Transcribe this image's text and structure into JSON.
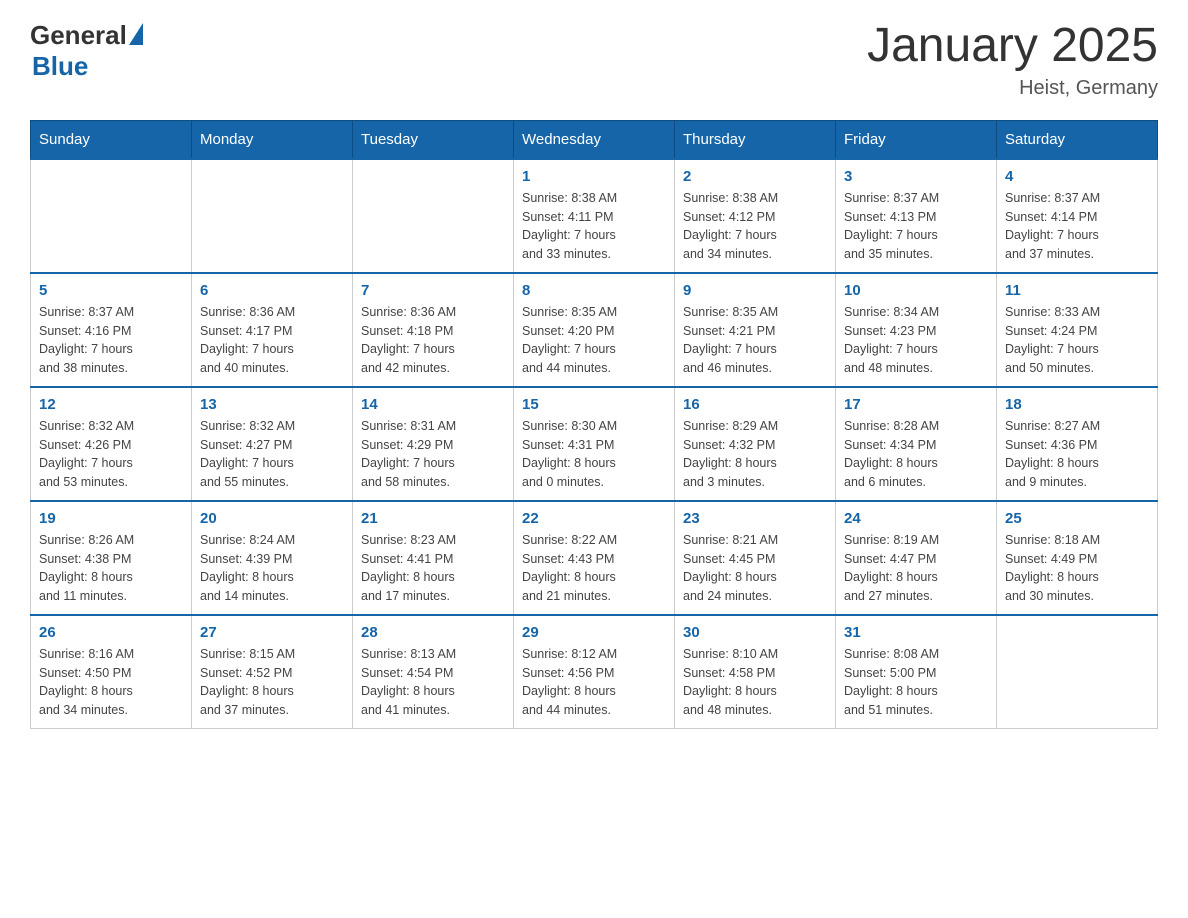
{
  "header": {
    "logo_general": "General",
    "logo_blue": "Blue",
    "title": "January 2025",
    "subtitle": "Heist, Germany"
  },
  "calendar": {
    "days_of_week": [
      "Sunday",
      "Monday",
      "Tuesday",
      "Wednesday",
      "Thursday",
      "Friday",
      "Saturday"
    ],
    "weeks": [
      [
        {
          "day": "",
          "info": ""
        },
        {
          "day": "",
          "info": ""
        },
        {
          "day": "",
          "info": ""
        },
        {
          "day": "1",
          "info": "Sunrise: 8:38 AM\nSunset: 4:11 PM\nDaylight: 7 hours\nand 33 minutes."
        },
        {
          "day": "2",
          "info": "Sunrise: 8:38 AM\nSunset: 4:12 PM\nDaylight: 7 hours\nand 34 minutes."
        },
        {
          "day": "3",
          "info": "Sunrise: 8:37 AM\nSunset: 4:13 PM\nDaylight: 7 hours\nand 35 minutes."
        },
        {
          "day": "4",
          "info": "Sunrise: 8:37 AM\nSunset: 4:14 PM\nDaylight: 7 hours\nand 37 minutes."
        }
      ],
      [
        {
          "day": "5",
          "info": "Sunrise: 8:37 AM\nSunset: 4:16 PM\nDaylight: 7 hours\nand 38 minutes."
        },
        {
          "day": "6",
          "info": "Sunrise: 8:36 AM\nSunset: 4:17 PM\nDaylight: 7 hours\nand 40 minutes."
        },
        {
          "day": "7",
          "info": "Sunrise: 8:36 AM\nSunset: 4:18 PM\nDaylight: 7 hours\nand 42 minutes."
        },
        {
          "day": "8",
          "info": "Sunrise: 8:35 AM\nSunset: 4:20 PM\nDaylight: 7 hours\nand 44 minutes."
        },
        {
          "day": "9",
          "info": "Sunrise: 8:35 AM\nSunset: 4:21 PM\nDaylight: 7 hours\nand 46 minutes."
        },
        {
          "day": "10",
          "info": "Sunrise: 8:34 AM\nSunset: 4:23 PM\nDaylight: 7 hours\nand 48 minutes."
        },
        {
          "day": "11",
          "info": "Sunrise: 8:33 AM\nSunset: 4:24 PM\nDaylight: 7 hours\nand 50 minutes."
        }
      ],
      [
        {
          "day": "12",
          "info": "Sunrise: 8:32 AM\nSunset: 4:26 PM\nDaylight: 7 hours\nand 53 minutes."
        },
        {
          "day": "13",
          "info": "Sunrise: 8:32 AM\nSunset: 4:27 PM\nDaylight: 7 hours\nand 55 minutes."
        },
        {
          "day": "14",
          "info": "Sunrise: 8:31 AM\nSunset: 4:29 PM\nDaylight: 7 hours\nand 58 minutes."
        },
        {
          "day": "15",
          "info": "Sunrise: 8:30 AM\nSunset: 4:31 PM\nDaylight: 8 hours\nand 0 minutes."
        },
        {
          "day": "16",
          "info": "Sunrise: 8:29 AM\nSunset: 4:32 PM\nDaylight: 8 hours\nand 3 minutes."
        },
        {
          "day": "17",
          "info": "Sunrise: 8:28 AM\nSunset: 4:34 PM\nDaylight: 8 hours\nand 6 minutes."
        },
        {
          "day": "18",
          "info": "Sunrise: 8:27 AM\nSunset: 4:36 PM\nDaylight: 8 hours\nand 9 minutes."
        }
      ],
      [
        {
          "day": "19",
          "info": "Sunrise: 8:26 AM\nSunset: 4:38 PM\nDaylight: 8 hours\nand 11 minutes."
        },
        {
          "day": "20",
          "info": "Sunrise: 8:24 AM\nSunset: 4:39 PM\nDaylight: 8 hours\nand 14 minutes."
        },
        {
          "day": "21",
          "info": "Sunrise: 8:23 AM\nSunset: 4:41 PM\nDaylight: 8 hours\nand 17 minutes."
        },
        {
          "day": "22",
          "info": "Sunrise: 8:22 AM\nSunset: 4:43 PM\nDaylight: 8 hours\nand 21 minutes."
        },
        {
          "day": "23",
          "info": "Sunrise: 8:21 AM\nSunset: 4:45 PM\nDaylight: 8 hours\nand 24 minutes."
        },
        {
          "day": "24",
          "info": "Sunrise: 8:19 AM\nSunset: 4:47 PM\nDaylight: 8 hours\nand 27 minutes."
        },
        {
          "day": "25",
          "info": "Sunrise: 8:18 AM\nSunset: 4:49 PM\nDaylight: 8 hours\nand 30 minutes."
        }
      ],
      [
        {
          "day": "26",
          "info": "Sunrise: 8:16 AM\nSunset: 4:50 PM\nDaylight: 8 hours\nand 34 minutes."
        },
        {
          "day": "27",
          "info": "Sunrise: 8:15 AM\nSunset: 4:52 PM\nDaylight: 8 hours\nand 37 minutes."
        },
        {
          "day": "28",
          "info": "Sunrise: 8:13 AM\nSunset: 4:54 PM\nDaylight: 8 hours\nand 41 minutes."
        },
        {
          "day": "29",
          "info": "Sunrise: 8:12 AM\nSunset: 4:56 PM\nDaylight: 8 hours\nand 44 minutes."
        },
        {
          "day": "30",
          "info": "Sunrise: 8:10 AM\nSunset: 4:58 PM\nDaylight: 8 hours\nand 48 minutes."
        },
        {
          "day": "31",
          "info": "Sunrise: 8:08 AM\nSunset: 5:00 PM\nDaylight: 8 hours\nand 51 minutes."
        },
        {
          "day": "",
          "info": ""
        }
      ]
    ]
  }
}
